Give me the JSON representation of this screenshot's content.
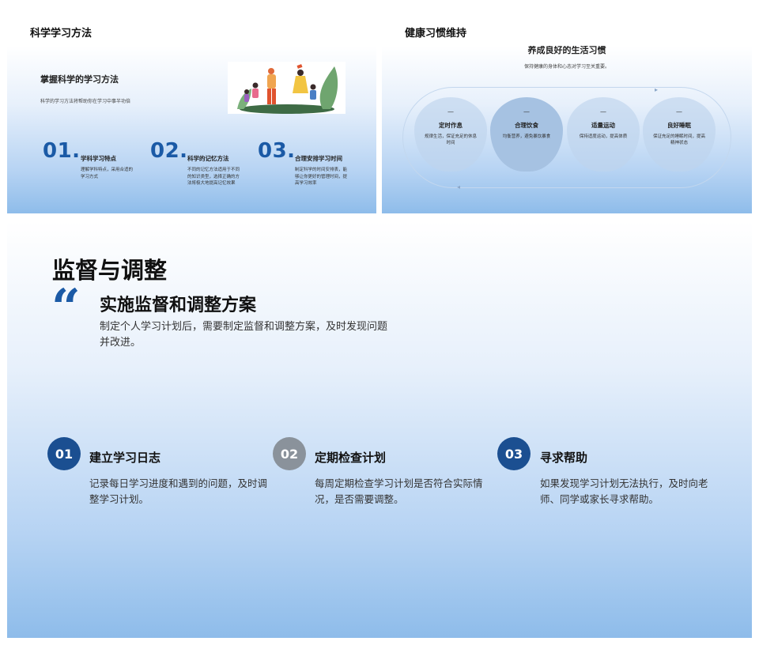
{
  "slide1": {
    "label": "科学学习方法",
    "title": "掌握科学的学习方法",
    "subtitle": "科学的学习方法将帮助你在学习中事半功倍",
    "items": [
      {
        "num": "01.",
        "title": "学科学习特点",
        "desc": "理解学科特点，采用合适的学习方式"
      },
      {
        "num": "02.",
        "title": "科学的记忆方法",
        "desc": "不同的记忆方法适用于不同的知识类型，选择正确的方法将极大地提高记忆效果"
      },
      {
        "num": "03.",
        "title": "合理安排学习时间",
        "desc": "制定科学的时间安排表，能够让你更好的管理时间，提高学习效率"
      }
    ]
  },
  "slide2": {
    "label": "健康习惯维持",
    "title": "养成良好的生活习惯",
    "subtitle": "保持健康的身体和心态对学习至关重要。",
    "items": [
      {
        "dash": "—",
        "title": "定时作息",
        "desc": "规律生活，保证充足的休息时间"
      },
      {
        "dash": "—",
        "title": "合理饮食",
        "desc": "均衡营养，避免暴饮暴食"
      },
      {
        "dash": "—",
        "title": "适量运动",
        "desc": "保持适度运动，提高体质"
      },
      {
        "dash": "—",
        "title": "良好睡眠",
        "desc": "保证充足的睡眠时间，提高精神状态"
      }
    ]
  },
  "slide3": {
    "title": "监督与调整",
    "quote_mark": "“",
    "heading": "实施监督和调整方案",
    "desc": "制定个人学习计划后，需要制定监督和调整方案，及时发现问题并改进。",
    "steps": [
      {
        "num": "01",
        "title": "建立学习日志",
        "desc": "记录每日学习进度和遇到的问题，及时调整学习计划。"
      },
      {
        "num": "02",
        "title": "定期检查计划",
        "desc": "每周定期检查学习计划是否符合实际情况，是否需要调整。"
      },
      {
        "num": "03",
        "title": "寻求帮助",
        "desc": "如果发现学习计划无法执行，及时向老师、同学或家长寻求帮助。"
      }
    ]
  },
  "colors": {
    "accent": "#1b5aa6",
    "circle_dark": "#1b4f91",
    "circle_grey": "#8a929b",
    "gradient_bottom": "#8ebcea"
  }
}
